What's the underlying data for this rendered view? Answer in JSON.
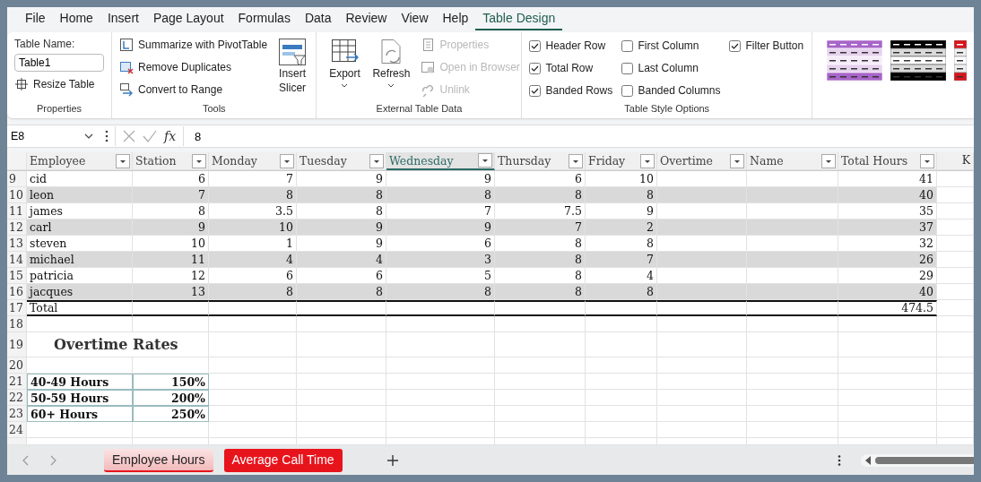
{
  "ribbon_tabs": [
    {
      "label": "File",
      "selected": false
    },
    {
      "label": "Home",
      "selected": false
    },
    {
      "label": "Insert",
      "selected": false
    },
    {
      "label": "Page Layout",
      "selected": false
    },
    {
      "label": "Formulas",
      "selected": false
    },
    {
      "label": "Data",
      "selected": false
    },
    {
      "label": "Review",
      "selected": false
    },
    {
      "label": "View",
      "selected": false
    },
    {
      "label": "Help",
      "selected": false
    },
    {
      "label": "Table Design",
      "selected": true
    }
  ],
  "ribbon": {
    "groups": [
      {
        "kind": "properties",
        "label": "Properties",
        "name_label": "Table Name:",
        "name_value": "Table1",
        "buttons": [
          {
            "label": "Resize Table",
            "disabled": false
          }
        ]
      },
      {
        "kind": "tools",
        "label": "Tools",
        "buttons": [
          {
            "label": "Summarize with PivotTable",
            "disabled": false
          },
          {
            "label": "Remove Duplicates",
            "disabled": false
          },
          {
            "label": "Convert to Range",
            "disabled": false
          }
        ],
        "big_buttons": [
          {
            "label": "Insert Slicer"
          }
        ]
      },
      {
        "kind": "external",
        "label": "External Table Data",
        "big_buttons": [
          {
            "label": "Export"
          },
          {
            "label": "Refresh"
          }
        ],
        "buttons": [
          {
            "label": "Properties",
            "disabled": true
          },
          {
            "label": "Open in Browser",
            "disabled": true
          },
          {
            "label": "Unlink",
            "disabled": true
          }
        ]
      },
      {
        "kind": "options",
        "label": "Table Style Options",
        "options": [
          {
            "label": "Header Row",
            "checked": true
          },
          {
            "label": "Total Row",
            "checked": true
          },
          {
            "label": "Banded Rows",
            "checked": true
          },
          {
            "label": "First Column",
            "checked": false
          },
          {
            "label": "Last Column",
            "checked": false
          },
          {
            "label": "Banded Columns",
            "checked": false
          },
          {
            "label": "Filter Button",
            "checked": true
          }
        ]
      },
      {
        "kind": "styles"
      }
    ]
  },
  "formula_bar": {
    "name_box": "E8",
    "fx": "fx",
    "formula": "8"
  },
  "sheet": {
    "columns": [
      {
        "label": "Employee",
        "selected": false
      },
      {
        "label": "Station",
        "selected": false
      },
      {
        "label": "Monday",
        "selected": false
      },
      {
        "label": "Tuesday",
        "selected": false
      },
      {
        "label": "Wednesday",
        "selected": true
      },
      {
        "label": "Thursday",
        "selected": false
      },
      {
        "label": "Friday",
        "selected": false
      },
      {
        "label": "Overtime",
        "selected": false
      },
      {
        "label": "Name",
        "selected": false
      },
      {
        "label": "Total Hours",
        "selected": false
      }
    ],
    "extra_column": "K",
    "rows": [
      {
        "number": "9",
        "cells": [
          "cid",
          "6",
          "7",
          "9",
          "9",
          "6",
          "10",
          null,
          null,
          "41"
        ]
      },
      {
        "number": "10",
        "cells": [
          "leon",
          "7",
          "8",
          "8",
          "8",
          "8",
          "8",
          null,
          null,
          "40"
        ]
      },
      {
        "number": "11",
        "cells": [
          "james",
          "8",
          "3.5",
          "8",
          "7",
          "7.5",
          "9",
          null,
          null,
          "35"
        ]
      },
      {
        "number": "12",
        "cells": [
          "carl",
          "9",
          "10",
          "9",
          "9",
          "7",
          "2",
          null,
          null,
          "37"
        ]
      },
      {
        "number": "13",
        "cells": [
          "steven",
          "10",
          "1",
          "9",
          "6",
          "8",
          "8",
          null,
          null,
          "32"
        ]
      },
      {
        "number": "14",
        "cells": [
          "michael",
          "11",
          "4",
          "4",
          "3",
          "8",
          "7",
          null,
          null,
          "26"
        ]
      },
      {
        "number": "15",
        "cells": [
          "patricia",
          "12",
          "6",
          "6",
          "5",
          "8",
          "4",
          null,
          null,
          "29"
        ]
      },
      {
        "number": "16",
        "cells": [
          "jacques",
          "13",
          "8",
          "8",
          "8",
          "8",
          "8",
          null,
          null,
          "40"
        ]
      }
    ],
    "total_row": {
      "number": "17",
      "label": "Total",
      "total_hours": "474.5"
    },
    "lower_rows": [
      {
        "number": "18",
        "kind": "blank"
      },
      {
        "number": "19",
        "kind": "title",
        "text": "Overtime Rates"
      },
      {
        "number": "20",
        "kind": "blank"
      },
      {
        "number": "21",
        "kind": "rate",
        "label": "40-49 Hours",
        "value": "150%"
      },
      {
        "number": "22",
        "kind": "rate",
        "label": "50-59 Hours",
        "value": "200%"
      },
      {
        "number": "23",
        "kind": "rate",
        "label": "60+ Hours",
        "value": "250%"
      },
      {
        "number": "24",
        "kind": "blank"
      }
    ]
  },
  "sheet_tabs": [
    {
      "label": "Employee Hours",
      "selected": true,
      "color": "#e8141c"
    },
    {
      "label": "Average Call Time",
      "selected": false,
      "color": "#e8141c"
    }
  ]
}
